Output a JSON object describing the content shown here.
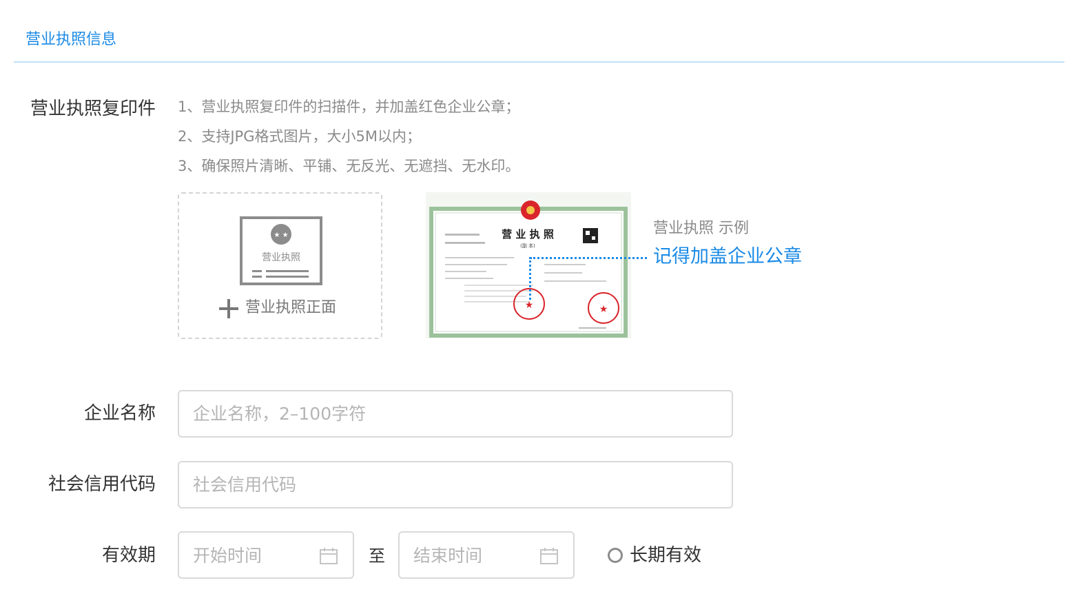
{
  "section": {
    "title": "营业执照信息"
  },
  "license_copy": {
    "label": "营业执照复印件",
    "hints": [
      "1、营业执照复印件的扫描件，并加盖红色企业公章；",
      "2、支持JPG格式图片，大小5M以内；",
      "3、确保照片清晰、平铺、无反光、无遮挡、无水印。"
    ],
    "upload": {
      "icon_text": "营业执照",
      "label": "营业执照正面"
    },
    "example": {
      "caption": "营业执照 示例",
      "note": "记得加盖企业公章",
      "doc_title": "营 业 执 照",
      "doc_subtitle": "(副 本)"
    }
  },
  "company_name": {
    "label": "企业名称",
    "placeholder": "企业名称，2–100字符"
  },
  "credit_code": {
    "label": "社会信用代码",
    "placeholder": "社会信用代码"
  },
  "validity": {
    "label": "有效期",
    "start_placeholder": "开始时间",
    "separator": "至",
    "end_placeholder": "结束时间",
    "long_term_label": "长期有效"
  },
  "colors": {
    "accent": "#1a8ae6",
    "seal_red": "#d9252b",
    "border": "#d9d9d9"
  },
  "icons": {
    "upload": "license-icon",
    "add": "plus-icon",
    "calendar": "calendar-icon",
    "radio": "radio-icon"
  }
}
